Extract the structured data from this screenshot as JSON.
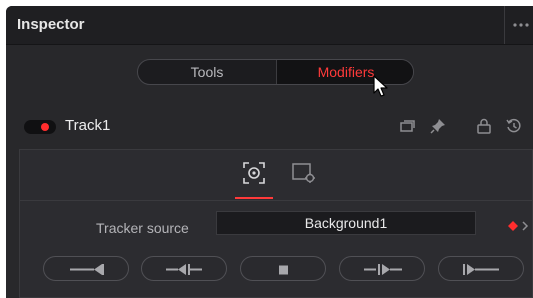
{
  "header": {
    "title": "Inspector",
    "more_icon": "ellipsis-icon"
  },
  "segmented": {
    "tabs": [
      {
        "label": "Tools",
        "active": false
      },
      {
        "label": "Modifiers",
        "active": true
      }
    ],
    "active_color": "#ff3a3a"
  },
  "node": {
    "name": "Track1",
    "enabled": true,
    "header_icons": [
      "versions-icon",
      "pin-icon",
      "lock-icon",
      "reset-icon"
    ]
  },
  "panel": {
    "subtabs": [
      {
        "icon": "tracker-icon",
        "active": true
      },
      {
        "icon": "settings-icon",
        "active": false
      }
    ],
    "tracker_source": {
      "label": "Tracker source",
      "value": "Background1"
    },
    "transport_buttons": [
      "track-reverse-icon",
      "track-reverse-step-icon",
      "stop-icon",
      "track-forward-step-icon",
      "track-forward-icon"
    ]
  },
  "colors": {
    "accent": "#ff3a3a",
    "background": "#28282b",
    "header": "#1f1f22"
  }
}
